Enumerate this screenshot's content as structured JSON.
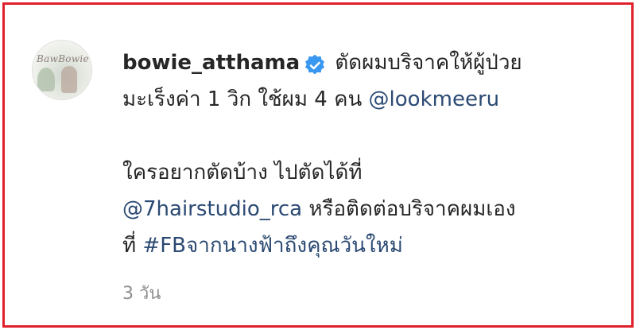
{
  "avatar": {
    "logo_text": "BawBowie"
  },
  "comment": {
    "username": "bowie_atthama",
    "verified_icon": "verified-badge-icon",
    "line1_text": " ตัดผมบริจาคให้ผู้ป่วย",
    "line2_text": "มะเร็งค่า 1 วิก ใช้ผม 4 คน ",
    "mention1": "@lookmeeru",
    "line3_text": "ใครอยากตัดบ้าง ไปตัดได้ที่",
    "mention2": "@7hairstudio_rca",
    "line4_text": " หรือติดต่อบริจาคผมเอง",
    "line5_text": "ที่ ",
    "hashtag": "#FBจากนางฟ้าถึงคุณวันใหม่"
  },
  "timestamp": "3 วัน",
  "colors": {
    "border": "#e0202a",
    "link": "#2b4a73",
    "verified": "#3897f0",
    "muted": "#8e8e8e"
  }
}
